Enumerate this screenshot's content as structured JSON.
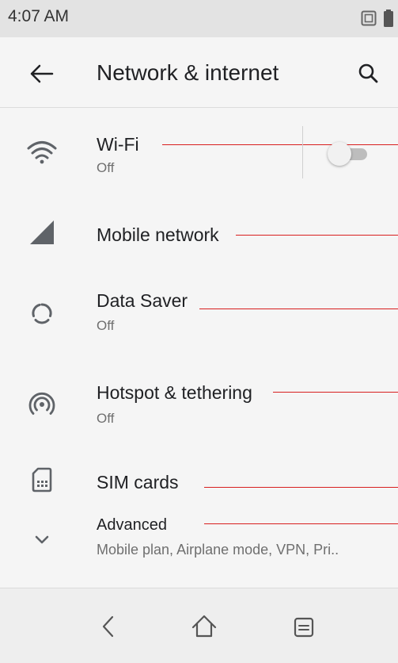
{
  "status_bar": {
    "time": "4:07 AM",
    "icons": [
      "sim-status-icon",
      "battery-icon"
    ]
  },
  "app_bar": {
    "title": "Network & internet",
    "back_icon": "arrow-left-icon",
    "search_icon": "search-icon"
  },
  "items": [
    {
      "title": "Wi-Fi",
      "subtitle": "Off",
      "icon": "wifi-icon",
      "toggle_on": false
    },
    {
      "title": "Mobile network",
      "icon": "cell-signal-icon"
    },
    {
      "title": "Data Saver",
      "subtitle": "Off",
      "icon": "data-saver-icon"
    },
    {
      "title": "Hotspot & tethering",
      "subtitle": "Off",
      "icon": "hotspot-icon"
    },
    {
      "title": "SIM cards",
      "icon": "sim-card-icon"
    },
    {
      "title": "Advanced",
      "subtitle": "Mobile plan, Airplane mode, VPN, Pri..",
      "icon": "chevron-down-icon"
    }
  ],
  "nav_bar": {
    "icons": [
      "back-nav-icon",
      "home-nav-icon",
      "recents-nav-icon"
    ]
  },
  "colors": {
    "background": "#f5f5f5",
    "status_bar": "#e3e3e3",
    "annotation_line": "#d81f1f",
    "icon_gray": "#5f6368"
  }
}
